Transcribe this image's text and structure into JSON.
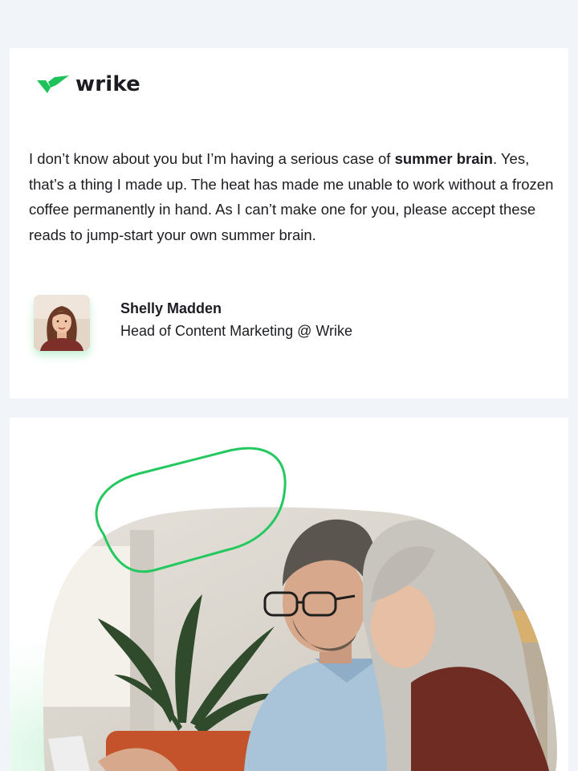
{
  "brand": {
    "logo_text": "wrike",
    "accent_color": "#1dc35a",
    "icon": "wrike-check-icon"
  },
  "intro": {
    "text_before": "I don’t know about you but I’m having a serious case of ",
    "highlight": "summer brain",
    "text_after": ". Yes, that’s a thing I made up. The heat has made me unable to work without a frozen coffee permanently in hand. As I can’t make one for you, please accept these reads to jump-start your own summer brain."
  },
  "author": {
    "name": "Shelly Madden",
    "title": "Head of Content Marketing @ Wrike",
    "avatar_icon": "portrait-photo"
  },
  "hero": {
    "image": "photo-two-people-looking-at-laptop",
    "decoration": "green-outline-pill"
  }
}
